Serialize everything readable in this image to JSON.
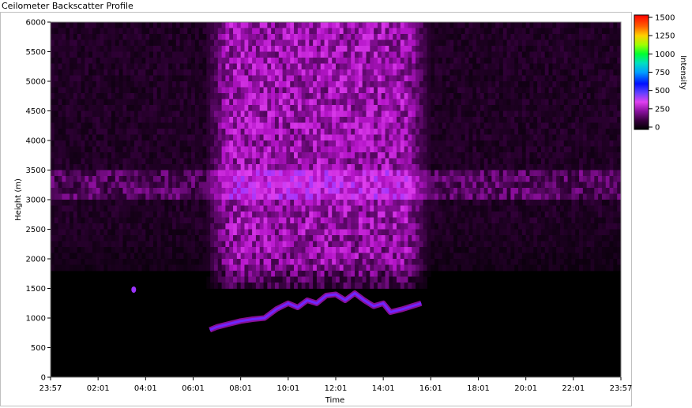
{
  "window": {
    "title": "Ceilometer Backscatter Profile"
  },
  "colors": {
    "plot_background": "#000000",
    "colormap": [
      "#000000",
      "#2a0030",
      "#6a0a78",
      "#b414c8",
      "#e040f0",
      "#8a30ff",
      "#0000ff",
      "#00c0ff",
      "#00ff40",
      "#c0ff00",
      "#ffd000",
      "#ff6000",
      "#ff0000"
    ]
  },
  "chart_data": {
    "type": "heatmap",
    "title": "",
    "xlabel": "Time",
    "ylabel": "Height (m)",
    "x_ticks": [
      "23:57",
      "02:01",
      "04:01",
      "06:01",
      "08:01",
      "10:01",
      "12:01",
      "14:01",
      "16:01",
      "18:01",
      "20:01",
      "22:01",
      "23:57"
    ],
    "y_ticks": [
      "0",
      "500",
      "1000",
      "1500",
      "2000",
      "2500",
      "3000",
      "3500",
      "4000",
      "4500",
      "5000",
      "5500",
      "6000"
    ],
    "ylim": [
      0,
      6000
    ],
    "xlim_hours": [
      0,
      24
    ],
    "colorbar": {
      "label": "Intensity",
      "ticks": [
        "0",
        "250",
        "500",
        "750",
        "1000",
        "1250",
        "1500"
      ],
      "range": [
        0,
        1500
      ]
    },
    "features": {
      "isolated_return": {
        "hour": 3.5,
        "height": 1480,
        "intensity": 600
      },
      "boundary_layer_top": {
        "hours": [
          6.7,
          7.0,
          7.5,
          8.0,
          8.5,
          9.0,
          9.5,
          10.0,
          10.4,
          10.8,
          11.2,
          11.6,
          12.0,
          12.4,
          12.8,
          13.2,
          13.6,
          14.0,
          14.3,
          14.8,
          15.2,
          15.6
        ],
        "heights": [
          800,
          850,
          900,
          950,
          980,
          1000,
          1150,
          1250,
          1180,
          1300,
          1250,
          1380,
          1400,
          1300,
          1420,
          1300,
          1200,
          1250,
          1100,
          1150,
          1200,
          1250
        ],
        "intensity": 650
      },
      "high_noise_region": {
        "hours": [
          6.5,
          16.0
        ],
        "height_range": [
          2000,
          6000
        ],
        "intensity": 250
      },
      "residual_layer": {
        "height_range": [
          3000,
          3500
        ],
        "intensity": 120
      }
    }
  }
}
